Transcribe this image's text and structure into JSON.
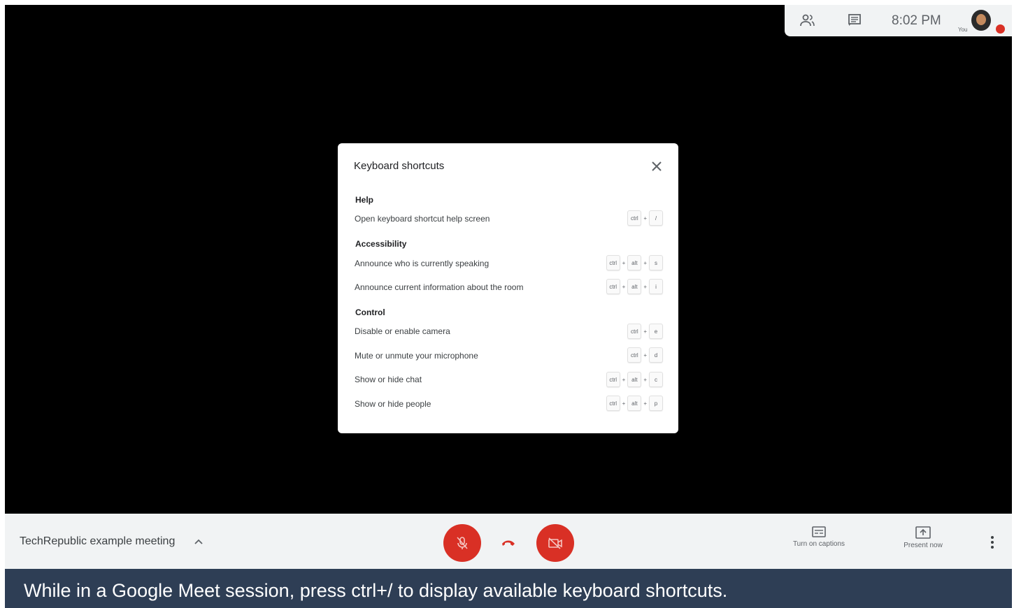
{
  "topbar": {
    "time": "8:02 PM",
    "you_label": "You",
    "icons": [
      "people-icon",
      "chat-icon",
      "avatar"
    ]
  },
  "dialog": {
    "title": "Keyboard shortcuts",
    "sections": [
      {
        "heading": "Help",
        "rows": [
          {
            "label": "Open keyboard shortcut help screen",
            "keys": [
              "ctrl",
              "/"
            ]
          }
        ]
      },
      {
        "heading": "Accessibility",
        "rows": [
          {
            "label": "Announce who is currently speaking",
            "keys": [
              "ctrl",
              "alt",
              "s"
            ]
          },
          {
            "label": "Announce current information about the room",
            "keys": [
              "ctrl",
              "alt",
              "i"
            ]
          }
        ]
      },
      {
        "heading": "Control",
        "rows": [
          {
            "label": "Disable or enable camera",
            "keys": [
              "ctrl",
              "e"
            ]
          },
          {
            "label": "Mute or unmute your microphone",
            "keys": [
              "ctrl",
              "d"
            ]
          },
          {
            "label": "Show or hide chat",
            "keys": [
              "ctrl",
              "alt",
              "c"
            ]
          },
          {
            "label": "Show or hide people",
            "keys": [
              "ctrl",
              "alt",
              "p"
            ]
          }
        ]
      }
    ],
    "plus": "+"
  },
  "bottombar": {
    "meeting_title": "TechRepublic example meeting",
    "captions_label": "Turn on captions",
    "present_label": "Present now"
  },
  "caption": "While in a Google Meet session, press ctrl+/ to display available keyboard shortcuts.",
  "colors": {
    "accent_red": "#d93025",
    "bar_bg": "#f1f3f4",
    "caption_bg": "#2e3e55"
  }
}
